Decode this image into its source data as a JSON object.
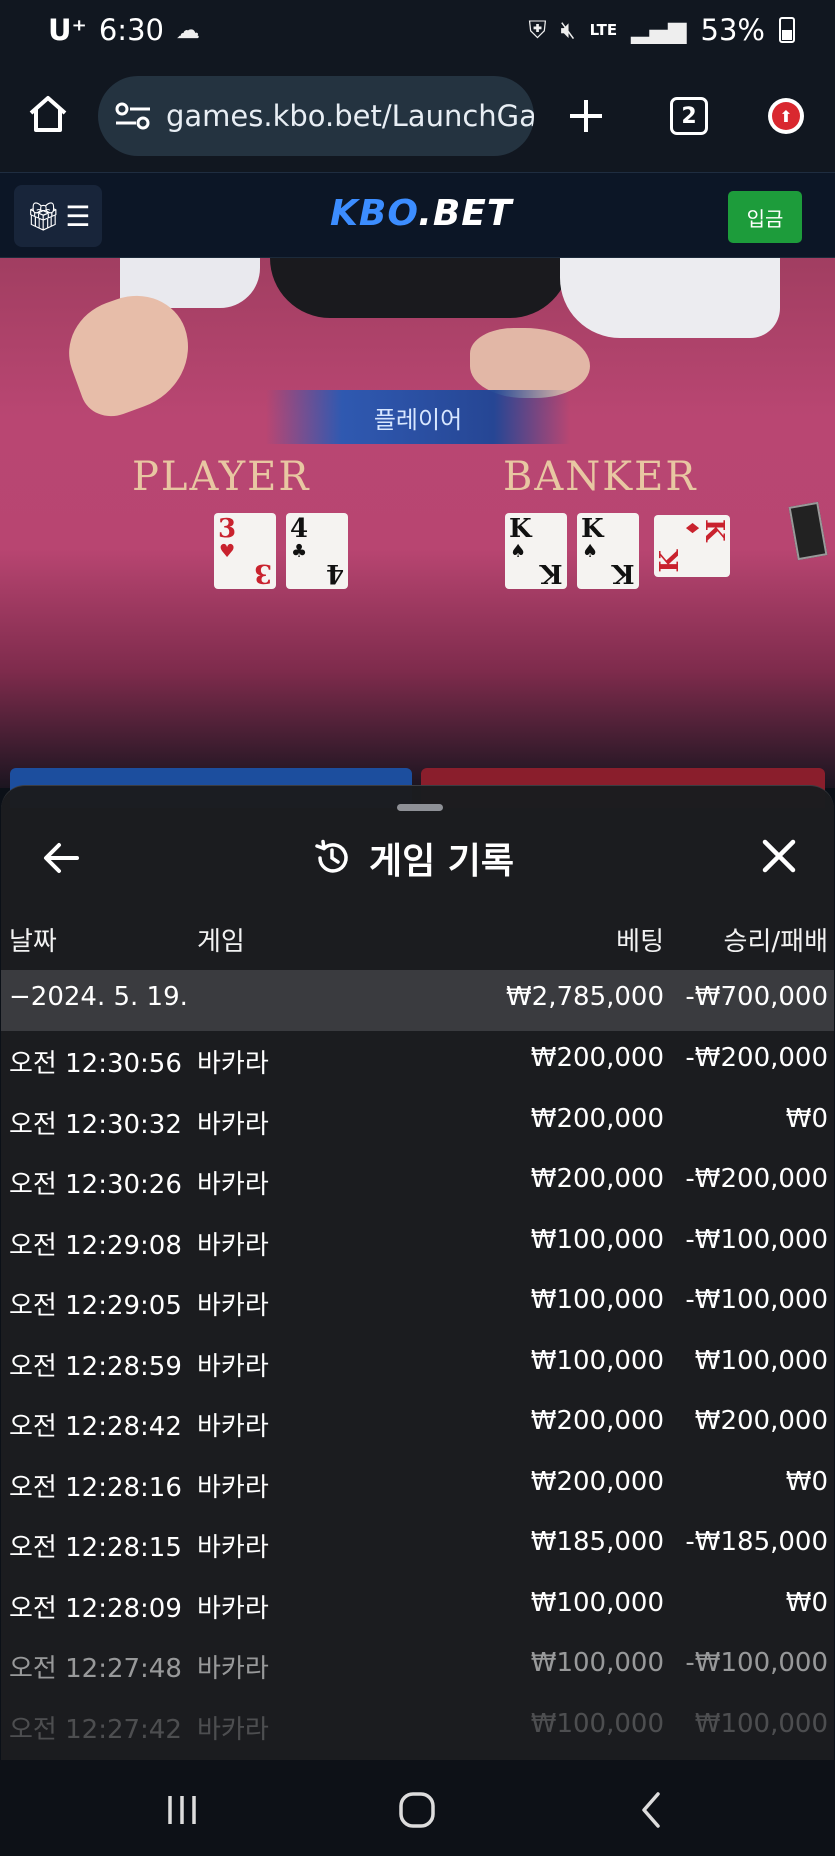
{
  "status_bar": {
    "carrier": "U⁺",
    "time": "6:30",
    "network": "LTE",
    "battery": "53%"
  },
  "browser": {
    "url": "games.kbo.bet/LaunchGam",
    "tab_count": "2"
  },
  "site_header": {
    "logo_main": "KBO",
    "logo_suffix": ".BET",
    "deposit_label": "입금"
  },
  "game_view": {
    "result_banner": "플레이어",
    "player_label": "PLAYER",
    "banker_label": "BANKER",
    "player_cards": [
      {
        "rank": "3",
        "suit": "♥",
        "color": "red"
      },
      {
        "rank": "4",
        "suit": "♣",
        "color": "black"
      }
    ],
    "banker_cards": [
      {
        "rank": "K",
        "suit": "♠",
        "color": "black"
      },
      {
        "rank": "K",
        "suit": "♠",
        "color": "black"
      },
      {
        "rank": "K",
        "suit": "♦",
        "color": "red"
      }
    ]
  },
  "history_panel": {
    "title": "게임 기록",
    "columns": {
      "date": "날짜",
      "game": "게임",
      "bet": "베팅",
      "win_loss": "승리/패배"
    },
    "summary": {
      "date": "−2024. 5. 19.",
      "bet": "₩2,785,000",
      "win_loss": "-₩700,000"
    },
    "rows": [
      {
        "date": "오전 12:30:56",
        "game": "바카라",
        "bet": "₩200,000",
        "win_loss": "-₩200,000"
      },
      {
        "date": "오전 12:30:32",
        "game": "바카라",
        "bet": "₩200,000",
        "win_loss": "₩0"
      },
      {
        "date": "오전 12:30:26",
        "game": "바카라",
        "bet": "₩200,000",
        "win_loss": "-₩200,000"
      },
      {
        "date": "오전 12:29:08",
        "game": "바카라",
        "bet": "₩100,000",
        "win_loss": "-₩100,000"
      },
      {
        "date": "오전 12:29:05",
        "game": "바카라",
        "bet": "₩100,000",
        "win_loss": "-₩100,000"
      },
      {
        "date": "오전 12:28:59",
        "game": "바카라",
        "bet": "₩100,000",
        "win_loss": "₩100,000"
      },
      {
        "date": "오전 12:28:42",
        "game": "바카라",
        "bet": "₩200,000",
        "win_loss": "₩200,000"
      },
      {
        "date": "오전 12:28:16",
        "game": "바카라",
        "bet": "₩200,000",
        "win_loss": "₩0"
      },
      {
        "date": "오전 12:28:15",
        "game": "바카라",
        "bet": "₩185,000",
        "win_loss": "-₩185,000"
      },
      {
        "date": "오전 12:28:09",
        "game": "바카라",
        "bet": "₩100,000",
        "win_loss": "₩0"
      },
      {
        "date": "오전 12:27:48",
        "game": "바카라",
        "bet": "₩100,000",
        "win_loss": "-₩100,000"
      },
      {
        "date": "오전 12:27:42",
        "game": "바카라",
        "bet": "₩100,000",
        "win_loss": "₩100,000"
      }
    ]
  },
  "colors": {
    "panel_bg": "#1b1c1f",
    "summary_bg": "#3a3b3f",
    "deposit_green": "#1d9c3b",
    "logo_blue": "#3c8dff",
    "table_pink": "#b94672"
  },
  "icons": {
    "home": "home-icon",
    "site_settings": "tune-icon",
    "new_tab": "plus-icon",
    "tabs": "tabs-icon",
    "update": "update-icon",
    "gift": "gift-icon",
    "menu": "hamburger-icon",
    "back": "arrow-left-icon",
    "history": "history-icon",
    "close": "close-icon",
    "recents": "recents-icon",
    "home_nav": "home-nav-icon",
    "back_nav": "back-nav-icon"
  }
}
